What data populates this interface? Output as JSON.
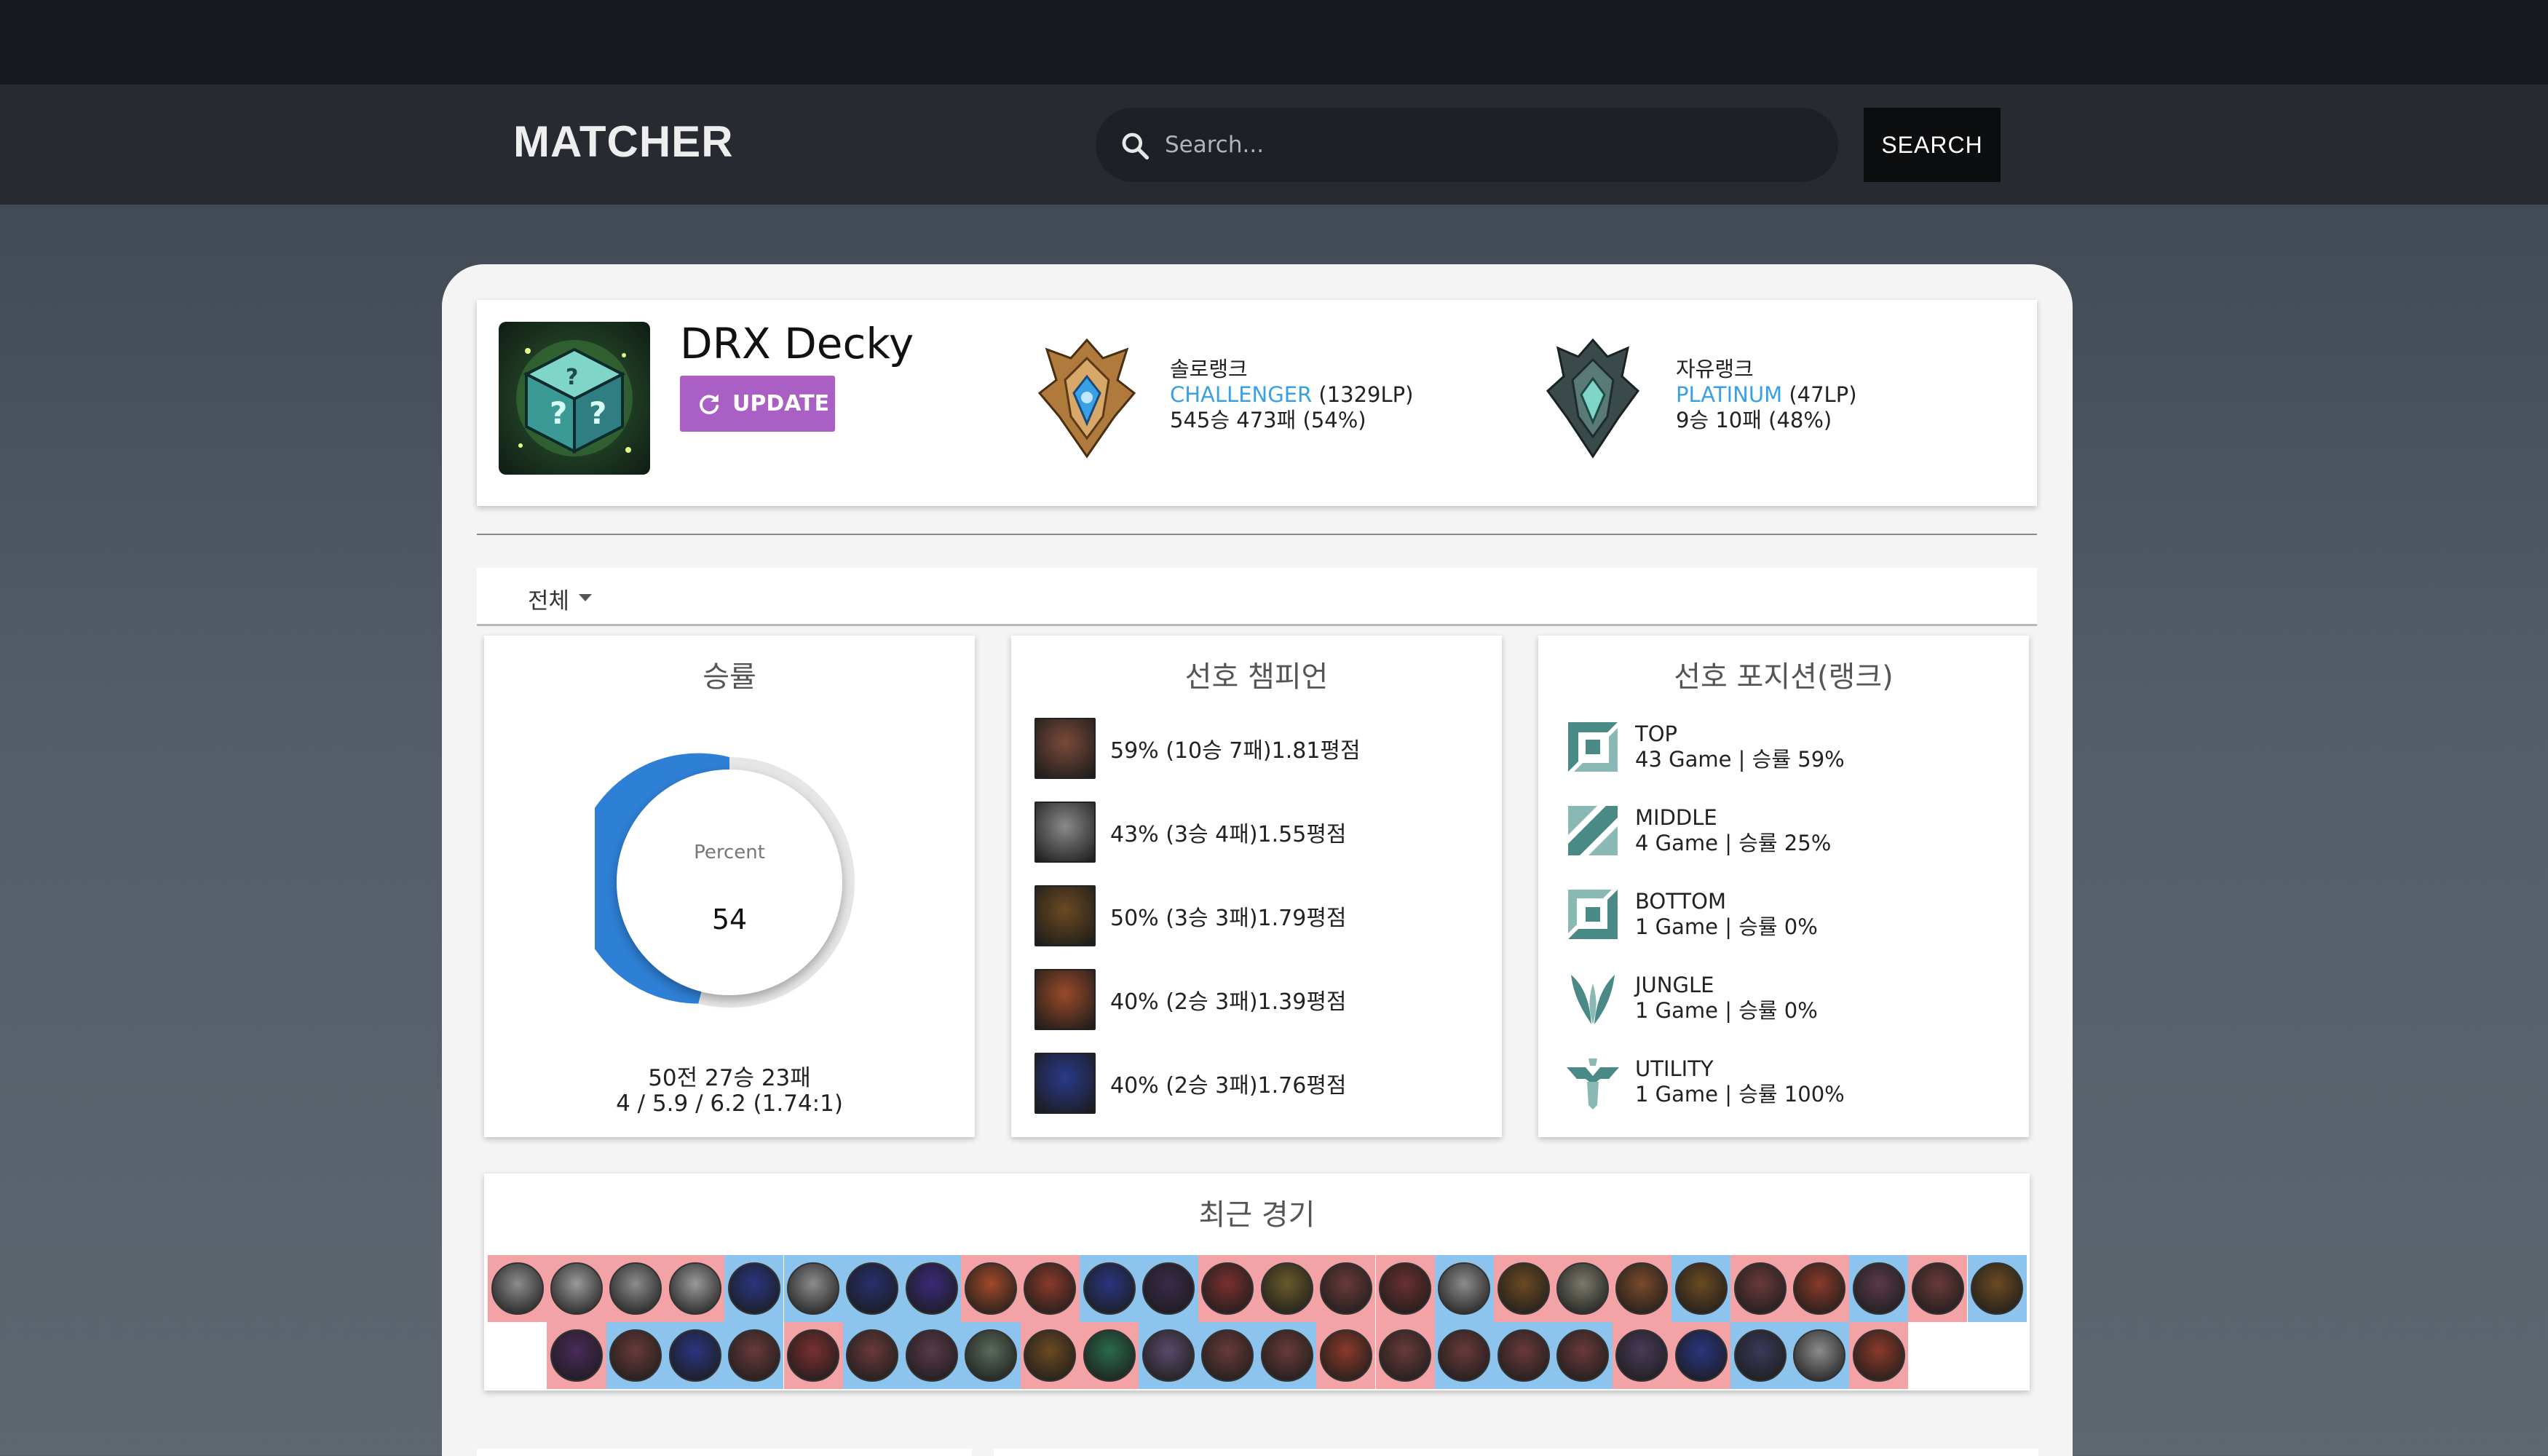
{
  "nav": {
    "logo": "MATCHER",
    "search_placeholder": "Search...",
    "search_button": "SEARCH"
  },
  "profile": {
    "name": "DRX Decky",
    "update_label": "UPDATE",
    "solo": {
      "queue": "솔로랭크",
      "tier": "CHALLENGER",
      "lp": " (1329LP)",
      "record": "545승 473패 (54%)",
      "emblem": "challenger-emblem"
    },
    "flex": {
      "queue": "자유랭크",
      "tier": "PLATINUM",
      "lp": " (47LP)",
      "record": "9승 10패 (48%)",
      "emblem": "platinum-emblem"
    }
  },
  "filter": {
    "selected": "전체"
  },
  "winrate": {
    "title": "승률",
    "donut_label": "Percent",
    "percent": 54,
    "percent_text": "54",
    "record_line1": "50전 27승 23패",
    "record_line2": "4 / 5.9 / 6.2 (1.74:1)"
  },
  "champions": {
    "title": "선호 챔피언",
    "items": [
      {
        "text": "59% (10승 7패)1.81평점",
        "color": "#7a4a3a"
      },
      {
        "text": "43% (3승 4패)1.55평점",
        "color": "#8a8a8a"
      },
      {
        "text": "50% (3승 3패)1.79평점",
        "color": "#6b4a22"
      },
      {
        "text": "40% (2승 3패)1.39평점",
        "color": "#9a4a2a"
      },
      {
        "text": "40% (2승 3패)1.76평점",
        "color": "#2a3a8a"
      }
    ]
  },
  "positions": {
    "title": "선호 포지션(랭크)",
    "items": [
      {
        "name": "TOP",
        "stats": "43 Game | 승률 59%",
        "icon": "top-lane-icon"
      },
      {
        "name": "MIDDLE",
        "stats": "4 Game | 승률 25%",
        "icon": "middle-lane-icon"
      },
      {
        "name": "BOTTOM",
        "stats": "1 Game | 승률 0%",
        "icon": "bottom-lane-icon"
      },
      {
        "name": "JUNGLE",
        "stats": "1 Game | 승률 0%",
        "icon": "jungle-icon"
      },
      {
        "name": "UTILITY",
        "stats": "1 Game | 승률 100%",
        "icon": "utility-icon"
      }
    ]
  },
  "recent": {
    "title": "최근 경기",
    "row1": [
      {
        "r": "loss",
        "c": "#8c8c8c"
      },
      {
        "r": "loss",
        "c": "#9a9a9a"
      },
      {
        "r": "loss",
        "c": "#8c8c8c"
      },
      {
        "r": "loss",
        "c": "#9a9a9a"
      },
      {
        "r": "win",
        "c": "#2a3680"
      },
      {
        "r": "win",
        "c": "#8c8c8c"
      },
      {
        "r": "win",
        "c": "#26306e"
      },
      {
        "r": "win",
        "c": "#3a2a7a"
      },
      {
        "r": "loss",
        "c": "#a04a2a"
      },
      {
        "r": "loss",
        "c": "#8a3a2a"
      },
      {
        "r": "win",
        "c": "#2a3680"
      },
      {
        "r": "win",
        "c": "#3a2a4a"
      },
      {
        "r": "loss",
        "c": "#7a3030"
      },
      {
        "r": "loss",
        "c": "#6a5a2a"
      },
      {
        "r": "loss",
        "c": "#6a3a3a"
      },
      {
        "r": "loss",
        "c": "#6a3030"
      },
      {
        "r": "win",
        "c": "#8c8c8c"
      },
      {
        "r": "loss",
        "c": "#6b4a22"
      },
      {
        "r": "loss",
        "c": "#7a7a6a"
      },
      {
        "r": "loss",
        "c": "#7a4a2a"
      },
      {
        "r": "win",
        "c": "#6b4a22"
      },
      {
        "r": "loss",
        "c": "#6a3a3a"
      },
      {
        "r": "loss",
        "c": "#8a3a2a"
      },
      {
        "r": "win",
        "c": "#5a3a4a"
      },
      {
        "r": "loss",
        "c": "#6a3a3a"
      },
      {
        "r": "win",
        "c": "#6b4a22"
      }
    ],
    "row2": [
      {
        "r": "empty",
        "c": ""
      },
      {
        "r": "loss",
        "c": "#4a2a5a"
      },
      {
        "r": "win",
        "c": "#6a3a3a"
      },
      {
        "r": "win",
        "c": "#2a3680"
      },
      {
        "r": "win",
        "c": "#6a3a3a"
      },
      {
        "r": "loss",
        "c": "#7a3030"
      },
      {
        "r": "win",
        "c": "#6a3a3a"
      },
      {
        "r": "win",
        "c": "#5a3a4a"
      },
      {
        "r": "win",
        "c": "#5a6a5a"
      },
      {
        "r": "loss",
        "c": "#6b4a22"
      },
      {
        "r": "loss",
        "c": "#2a6a4a"
      },
      {
        "r": "win",
        "c": "#5a4a6a"
      },
      {
        "r": "win",
        "c": "#6a3a3a"
      },
      {
        "r": "win",
        "c": "#6a3a3a"
      },
      {
        "r": "loss",
        "c": "#8a3a2a"
      },
      {
        "r": "loss",
        "c": "#6a3a3a"
      },
      {
        "r": "win",
        "c": "#6a3a3a"
      },
      {
        "r": "win",
        "c": "#6a3a3a"
      },
      {
        "r": "win",
        "c": "#6a3a3a"
      },
      {
        "r": "loss",
        "c": "#4a3a5a"
      },
      {
        "r": "loss",
        "c": "#2a3680"
      },
      {
        "r": "win",
        "c": "#3a3a5a"
      },
      {
        "r": "win",
        "c": "#8c8c8c"
      },
      {
        "r": "loss",
        "c": "#8a3a2a"
      },
      {
        "r": "empty",
        "c": ""
      }
    ]
  },
  "colors": {
    "accent": "#a95fc3",
    "tier": "#3aa0e6",
    "donut": "#2e7fd6",
    "win": "#8dc4ee",
    "loss": "#f3a3a6"
  }
}
